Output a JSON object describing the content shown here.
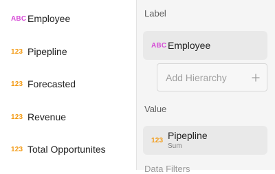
{
  "fields": [
    {
      "type": "ABC",
      "label": "Employee"
    },
    {
      "type": "123",
      "label": "Pipepline"
    },
    {
      "type": "123",
      "label": "Forecasted"
    },
    {
      "type": "123",
      "label": "Revenue"
    },
    {
      "type": "123",
      "label": "Total Opportunites"
    }
  ],
  "panel": {
    "label_title": "Label",
    "label_chip": {
      "type": "ABC",
      "label": "Employee"
    },
    "add_hierarchy_placeholder": "Add Hierarchy",
    "value_title": "Value",
    "value_chip": {
      "type": "123",
      "label": "Pipepline",
      "aggregation": "Sum"
    },
    "next_section_title": "Data Filters"
  },
  "colors": {
    "text_type": "#d64ad6",
    "number_type": "#f39a13",
    "panel_bg": "#f5f5f5",
    "chip_bg": "#e9e9e9"
  },
  "icons": {
    "add": "plus-icon"
  }
}
